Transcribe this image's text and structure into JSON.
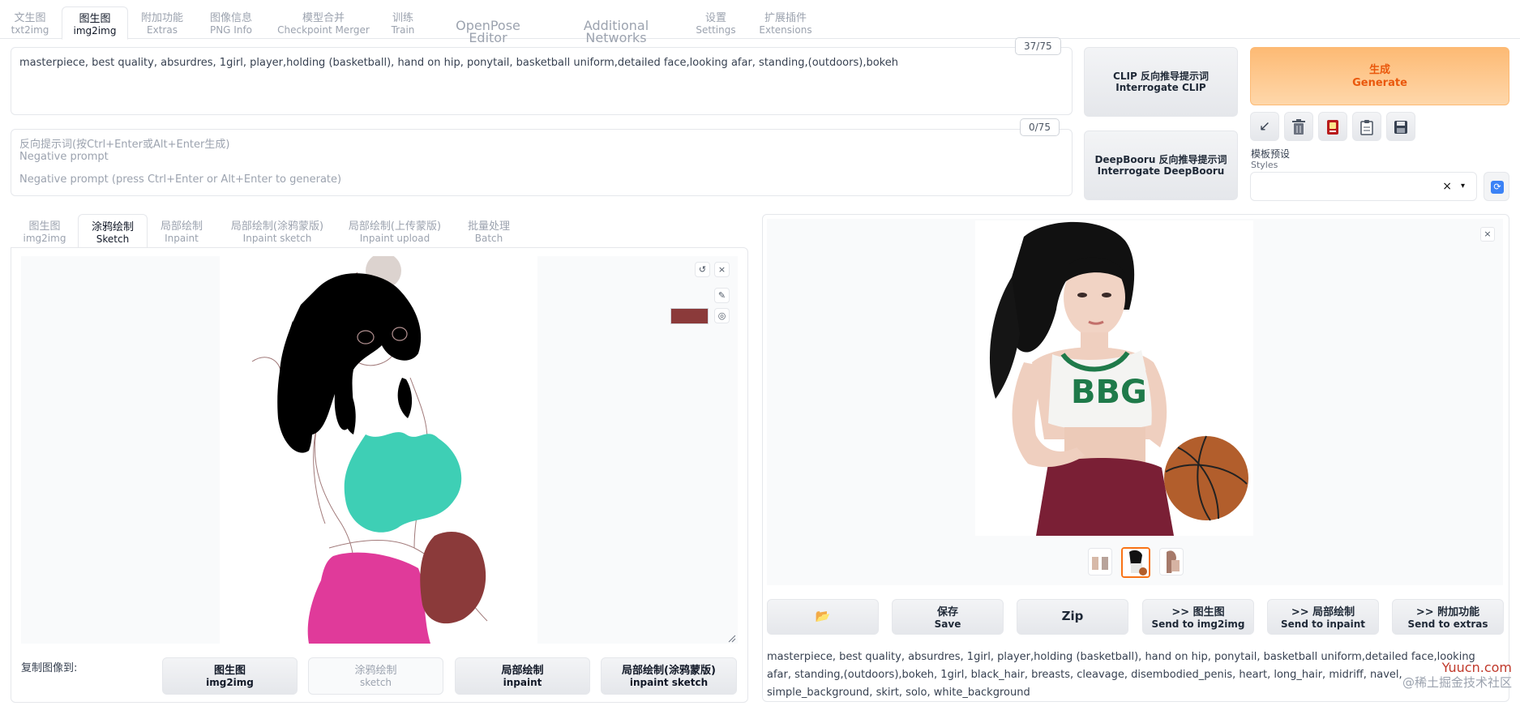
{
  "top_tabs": [
    {
      "label": "文生图",
      "sub": "txt2img"
    },
    {
      "label": "图生图",
      "sub": "img2img"
    },
    {
      "label": "附加功能",
      "sub": "Extras"
    },
    {
      "label": "图像信息",
      "sub": "PNG Info"
    },
    {
      "label": "模型合并",
      "sub": "Checkpoint Merger"
    },
    {
      "label": "训练",
      "sub": "Train"
    },
    {
      "label": "OpenPose Editor"
    },
    {
      "label": "Additional Networks"
    },
    {
      "label": "设置",
      "sub": "Settings"
    },
    {
      "label": "扩展插件",
      "sub": "Extensions"
    }
  ],
  "prompt": {
    "value": "masterpiece, best quality, absurdres, 1girl, player,holding (basketball), hand on hip, ponytail, basketball uniform,detailed face,looking afar, standing,(outdoors),bokeh",
    "counter": "37/75"
  },
  "negative_prompt": {
    "placeholder_line1": "反向提示词(按Ctrl+Enter或Alt+Enter生成)",
    "placeholder_line2": "Negative prompt",
    "placeholder_line3": "Negative prompt (press Ctrl+Enter or Alt+Enter to generate)",
    "counter": "0/75"
  },
  "interrogate_clip": {
    "label": "CLIP 反向推导提示词",
    "sub": "Interrogate CLIP"
  },
  "interrogate_deepbooru": {
    "label": "DeepBooru 反向推导提示词",
    "sub": "Interrogate DeepBooru"
  },
  "generate": {
    "label": "生成",
    "sub": "Generate"
  },
  "tools": [
    "arrow-icon",
    "trash-icon",
    "card-icon",
    "clipboard-icon",
    "save-icon"
  ],
  "styles": {
    "label": "模板预设",
    "sub": "Styles",
    "clear": "×",
    "arrow": "▾",
    "refresh": "⟳"
  },
  "sub_tabs": [
    {
      "label": "图生图",
      "sub": "img2img"
    },
    {
      "label": "涂鸦绘制",
      "sub": "Sketch"
    },
    {
      "label": "局部绘制",
      "sub": "Inpaint"
    },
    {
      "label": "局部绘制(涂鸦蒙版)",
      "sub": "Inpaint sketch"
    },
    {
      "label": "局部绘制(上传蒙版)",
      "sub": "Inpaint upload"
    },
    {
      "label": "批量处理",
      "sub": "Batch"
    }
  ],
  "sketch_tools": {
    "undo": "↺",
    "clear": "×",
    "brush": "✎",
    "palette": "◎"
  },
  "brush_color": "#8b3a3a",
  "copy_image_to": {
    "label": "复制图像到:",
    "buttons": [
      {
        "label": "图生图",
        "sub": "img2img"
      },
      {
        "label": "涂鸦绘制",
        "sub": "sketch"
      },
      {
        "label": "局部绘制",
        "sub": "inpaint"
      },
      {
        "label": "局部绘制(涂鸦蒙版)",
        "sub": "inpaint sketch"
      }
    ]
  },
  "gallery": {
    "close": "×"
  },
  "output_buttons": [
    {
      "label": "📂"
    },
    {
      "label": "保存",
      "sub": "Save"
    },
    {
      "label": "Zip"
    },
    {
      "label": ">> 图生图",
      "sub": "Send to img2img"
    },
    {
      "label": ">> 局部绘制",
      "sub": "Send to inpaint"
    },
    {
      "label": ">> 附加功能",
      "sub": "Send to extras"
    }
  ],
  "output_info": "masterpiece, best quality, absurdres, 1girl, player,holding (basketball), hand on hip, ponytail, basketball uniform,detailed face,looking afar, standing,(outdoors),bokeh, 1girl, black_hair, breasts, cleavage, disembodied_penis, heart, long_hair, midriff, navel, simple_background, skirt, solo, white_background",
  "jersey_text": "BBG",
  "watermark": {
    "accent": "Yuucn.com",
    "text": "@稀土掘金技术社区"
  }
}
